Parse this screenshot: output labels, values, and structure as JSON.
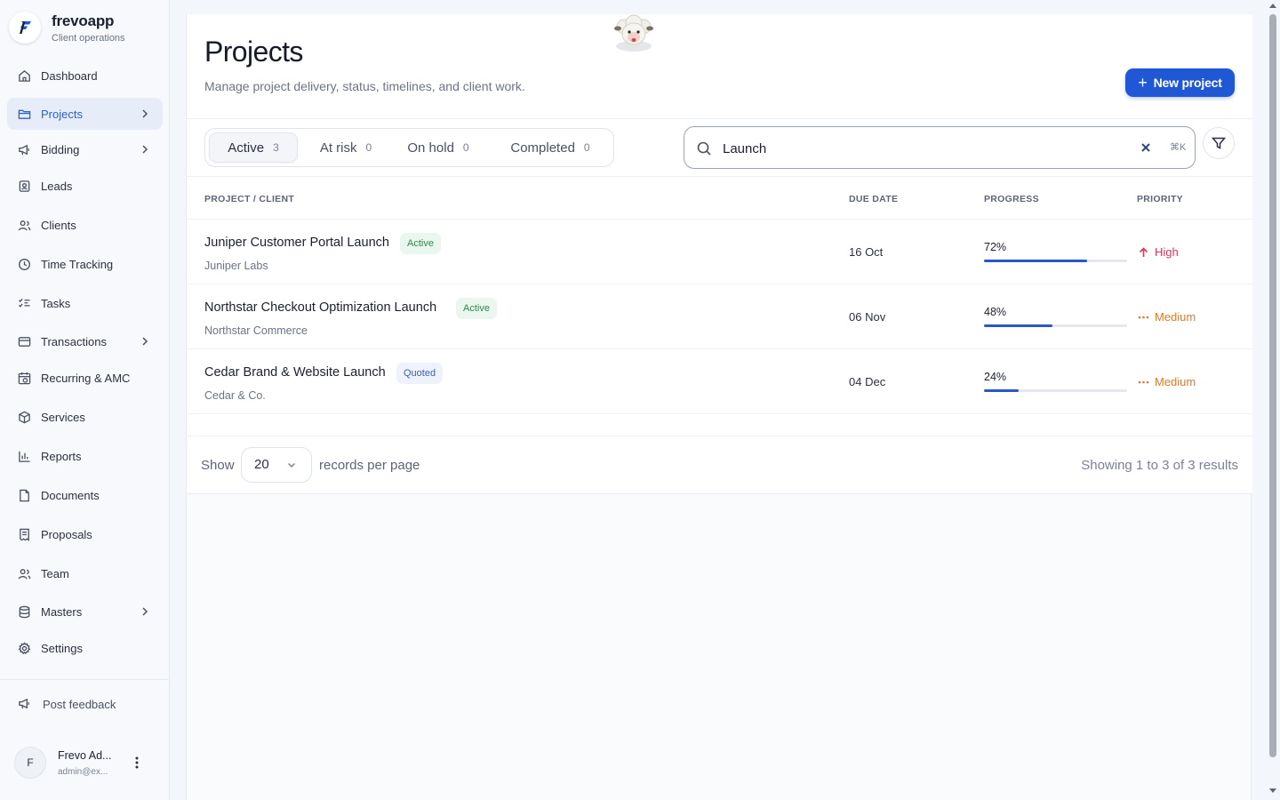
{
  "brand": {
    "name": "frevoapp",
    "subtitle": "Client operations"
  },
  "sidebar": {
    "items": [
      {
        "label": "Dashboard",
        "icon": "home-icon"
      },
      {
        "label": "Projects",
        "icon": "folder-icon",
        "active": true,
        "chevron": true
      },
      {
        "label": "Bidding",
        "icon": "megaphone-icon",
        "chevron": true
      },
      {
        "label": "Leads",
        "icon": "contact-book-icon"
      },
      {
        "label": "Clients",
        "icon": "users-icon"
      },
      {
        "label": "Time Tracking",
        "icon": "clock-icon"
      },
      {
        "label": "Tasks",
        "icon": "checklist-icon"
      },
      {
        "label": "Transactions",
        "icon": "credit-card-icon",
        "chevron": true
      },
      {
        "label": "Recurring & AMC",
        "icon": "calendar-repeat-icon"
      },
      {
        "label": "Services",
        "icon": "box-icon"
      },
      {
        "label": "Reports",
        "icon": "bar-chart-icon"
      },
      {
        "label": "Documents",
        "icon": "document-icon"
      },
      {
        "label": "Proposals",
        "icon": "receipt-icon"
      },
      {
        "label": "Team",
        "icon": "team-icon"
      },
      {
        "label": "Masters",
        "icon": "database-icon",
        "chevron": true
      },
      {
        "label": "Settings",
        "icon": "gear-icon"
      }
    ],
    "feedback_label": "Post feedback",
    "user": {
      "initial": "F",
      "name": "Frevo Ad...",
      "email": "admin@ex..."
    }
  },
  "header": {
    "title": "Projects",
    "subtitle": "Manage project delivery, status, timelines, and client work.",
    "new_button": "New project"
  },
  "tabs": [
    {
      "label": "Active",
      "count": "3",
      "active": true
    },
    {
      "label": "At risk",
      "count": "0"
    },
    {
      "label": "On hold",
      "count": "0"
    },
    {
      "label": "Completed",
      "count": "0"
    }
  ],
  "search": {
    "value": "Launch",
    "shortcut": "⌘K"
  },
  "table": {
    "columns": [
      "PROJECT / CLIENT",
      "DUE DATE",
      "PROGRESS",
      "PRIORITY"
    ],
    "rows": [
      {
        "project": "Juniper Customer Portal Launch",
        "status": "Active",
        "client": "Juniper Labs",
        "due": "16 Oct",
        "progress_label": "72%",
        "progress": 72,
        "priority": "High"
      },
      {
        "project": "Northstar Checkout Optimization Launch",
        "status": "Active",
        "client": "Northstar Commerce",
        "due": "06 Nov",
        "progress_label": "48%",
        "progress": 48,
        "priority": "Medium"
      },
      {
        "project": "Cedar Brand & Website Launch",
        "status": "Quoted",
        "client": "Cedar & Co.",
        "due": "04 Dec",
        "progress_label": "24%",
        "progress": 24,
        "priority": "Medium"
      }
    ]
  },
  "pager": {
    "show_label": "Show",
    "page_size": "20",
    "records_label": "records per page",
    "summary": "Showing 1 to 3 of 3 results"
  },
  "colors": {
    "accent": "#2057d4",
    "high": "#d43a5c",
    "medium": "#de7a25",
    "active_badge": "#2f8a4d",
    "quoted_badge": "#3a5fb8"
  }
}
